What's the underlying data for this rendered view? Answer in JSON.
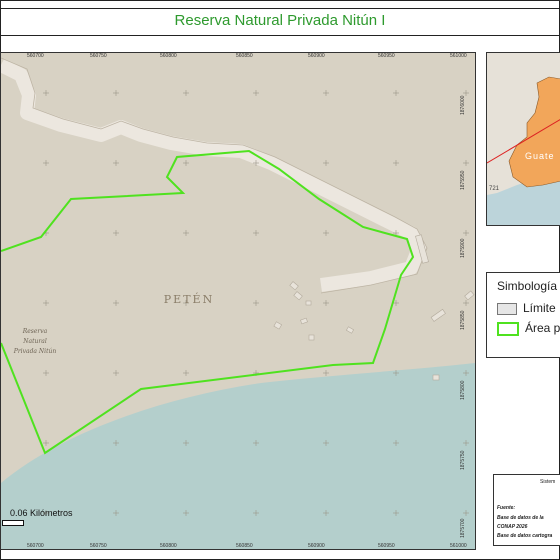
{
  "title": "Reserva Natural Privada Nitún I",
  "map": {
    "region_label": "PETÉN",
    "reserve_label_lines": [
      "Reserva",
      "Natural",
      "Privada Nitún"
    ],
    "colors": {
      "land": "#d8d2c4",
      "water": "#b4cfcc",
      "road": "#ece7df",
      "boundary": "#4fe21f"
    },
    "x_ticks_top": [
      "560700",
      "560750",
      "560800",
      "560850",
      "560900",
      "560950",
      "561000"
    ],
    "x_ticks_bottom": [
      "560700",
      "560750",
      "560800",
      "560850",
      "560900",
      "560950",
      "561000"
    ],
    "y_ticks_right": [
      "1876000",
      "1875950",
      "1875900",
      "1875850",
      "1875800",
      "1875750",
      "1875700"
    ]
  },
  "inset": {
    "label": "Guate",
    "number_label": "721",
    "colors": {
      "country": "#f2a65a",
      "sea": "#bcd4da",
      "land": "#e6e1d8",
      "line": "#d22"
    }
  },
  "legend": {
    "title": "Simbología",
    "items": [
      {
        "label": "Límite",
        "color": "#e6e6e6",
        "border": "#777777"
      },
      {
        "label": "Área pr",
        "color": "#ffffff",
        "border": "#4fe21f"
      }
    ]
  },
  "scale": {
    "label": "0.06 Kilómetros"
  },
  "source": {
    "header": "Sistem",
    "lines": [
      "Fuente:",
      "Base de datos de la",
      "CONAP 2026",
      "Base de datos cartogra"
    ]
  }
}
